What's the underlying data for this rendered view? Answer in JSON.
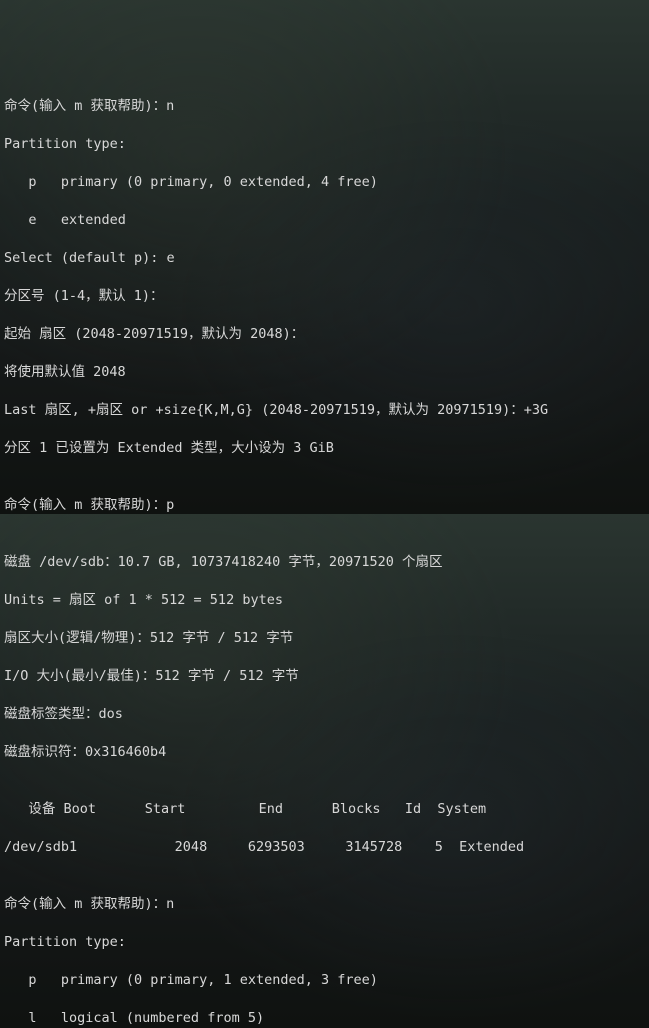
{
  "term": {
    "lines": [
      "命令(输入 m 获取帮助)：n",
      "Partition type:",
      "   p   primary (0 primary, 0 extended, 4 free)",
      "   e   extended",
      "Select (default p): e",
      "分区号 (1-4，默认 1)：",
      "起始 扇区 (2048-20971519，默认为 2048)：",
      "将使用默认值 2048",
      "Last 扇区, +扇区 or +size{K,M,G} (2048-20971519，默认为 20971519)：+3G",
      "分区 1 已设置为 Extended 类型，大小设为 3 GiB",
      "",
      "命令(输入 m 获取帮助)：p",
      "",
      "磁盘 /dev/sdb：10.7 GB, 10737418240 字节，20971520 个扇区",
      "Units = 扇区 of 1 * 512 = 512 bytes",
      "扇区大小(逻辑/物理)：512 字节 / 512 字节",
      "I/O 大小(最小/最佳)：512 字节 / 512 字节",
      "磁盘标签类型：dos",
      "磁盘标识符：0x316460b4",
      "",
      "   设备 Boot      Start         End      Blocks   Id  System",
      "/dev/sdb1            2048     6293503     3145728    5  Extended",
      "",
      "命令(输入 m 获取帮助)：n",
      "Partition type:",
      "   p   primary (0 primary, 1 extended, 3 free)",
      "   l   logical (numbered from 5)"
    ]
  }
}
